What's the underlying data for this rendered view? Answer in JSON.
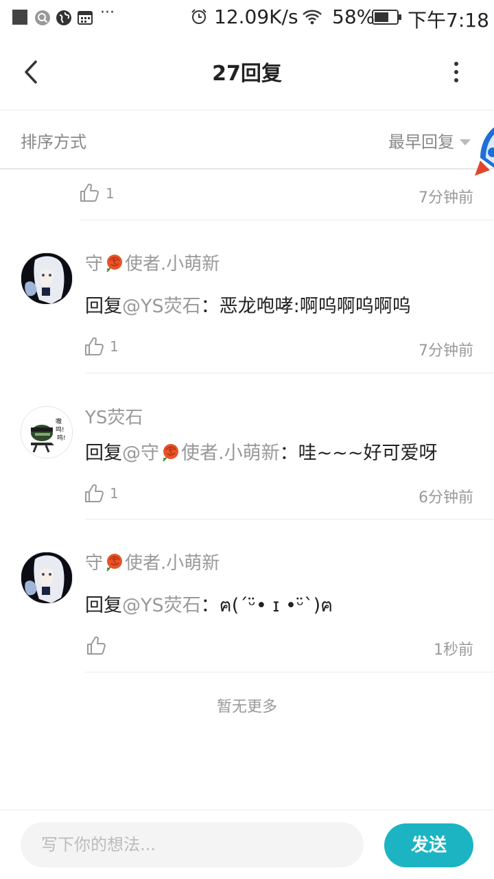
{
  "status_bar": {
    "network_speed": "12.09K/s",
    "battery": "58%",
    "time": "下午7:18",
    "icons": [
      "app-square-icon",
      "search-icon",
      "globe-icon",
      "calendar-icon",
      "more-notifications-icon",
      "alarm-icon",
      "wifi-icon",
      "battery-icon"
    ]
  },
  "header": {
    "title": "27回复",
    "back_icon": "chevron-left-icon",
    "more_icon": "more-vertical-icon"
  },
  "sort": {
    "label": "排序方式",
    "value": "最早回复"
  },
  "partial_item": {
    "likes": "1",
    "time": "7分钟前"
  },
  "replies": [
    {
      "user_prefix": "守",
      "user_suffix": "使者.小萌新",
      "reply_prefix": "回复",
      "mention": "@YS荧石",
      "colon": "：",
      "text": "恶龙咆哮:啊呜啊呜啊呜",
      "likes": "1",
      "time": "7分钟前"
    },
    {
      "user": "YS荧石",
      "reply_prefix": "回复",
      "mention_prefix": "@守",
      "mention_suffix": "使者.小萌新",
      "colon": "：",
      "text": "哇~~~好可爱呀",
      "likes": "1",
      "time": "6分钟前"
    },
    {
      "user_prefix": "守",
      "user_suffix": "使者.小萌新",
      "reply_prefix": "回复",
      "mention": "@YS荧石",
      "colon": "：",
      "text": "ฅ(ˊᵕ̈• ɪ •ᵕ̈ˋ)ฅ",
      "likes": "",
      "time": "1秒前"
    }
  ],
  "footer_text": "暂无更多",
  "composer": {
    "placeholder": "写下你的想法...",
    "send_label": "发送"
  },
  "colors": {
    "accent": "#1cb4c2",
    "muted_text": "#999999",
    "rose": "#e8532a"
  }
}
